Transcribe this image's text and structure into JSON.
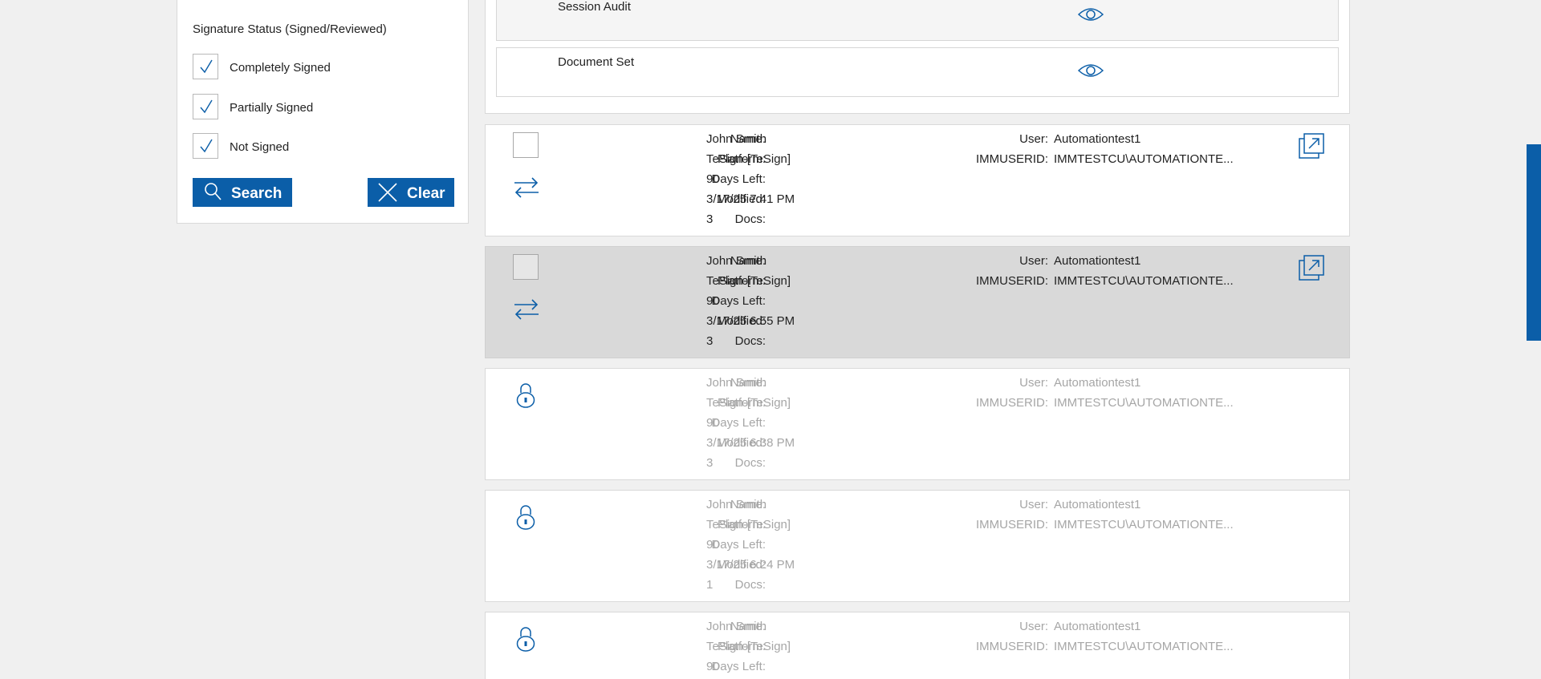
{
  "filter": {
    "title": "Signature Status (Signed/Reviewed)",
    "options": [
      {
        "label": "Completely Signed",
        "checked": true
      },
      {
        "label": "Partially Signed",
        "checked": true
      },
      {
        "label": "Not Signed",
        "checked": true
      }
    ],
    "search_label": "Search",
    "clear_label": "Clear"
  },
  "documents": [
    {
      "label": "Session Audit"
    },
    {
      "label": "Document Set"
    }
  ],
  "field_labels": {
    "name": "Name:",
    "platform": "Platform:",
    "days_left": "Days Left:",
    "modified": "Modified:",
    "docs": "Docs:",
    "user": "User:",
    "immuserid": "IMMUSERID:"
  },
  "sessions": [
    {
      "name": "John Smith",
      "platform": "TeSign-[TeSign]",
      "days_left": "90",
      "modified": "3/17/25 7:41 PM",
      "docs": "3",
      "user": "Automationtest1",
      "immuserid": "IMMTESTCU\\AUTOMATIONTE...",
      "locked": false,
      "selected": false
    },
    {
      "name": "John Smith",
      "platform": "TeSign-[TeSign]",
      "days_left": "90",
      "modified": "3/17/25 6:55 PM",
      "docs": "3",
      "user": "Automationtest1",
      "immuserid": "IMMTESTCU\\AUTOMATIONTE...",
      "locked": false,
      "selected": true
    },
    {
      "name": "John Smith",
      "platform": "TeSign-[TeSign]",
      "days_left": "90",
      "modified": "3/17/25 6:38 PM",
      "docs": "3",
      "user": "Automationtest1",
      "immuserid": "IMMTESTCU\\AUTOMATIONTE...",
      "locked": true,
      "selected": false
    },
    {
      "name": "John Smith",
      "platform": "TeSign-[TeSign]",
      "days_left": "90",
      "modified": "3/17/25 6:24 PM",
      "docs": "1",
      "user": "Automationtest1",
      "immuserid": "IMMTESTCU\\AUTOMATIONTE...",
      "locked": true,
      "selected": false
    },
    {
      "name": "John Smith",
      "platform": "TeSign-[TeSign]",
      "days_left": "90",
      "user": "Automationtest1",
      "immuserid": "IMMTESTCU\\AUTOMATIONTE...",
      "locked": true,
      "selected": false
    }
  ],
  "colors": {
    "accent": "#0b5ea8",
    "muted_text": "#a6a6a6",
    "selected_row": "#d9d9d9"
  },
  "icons": {
    "check": "check-icon",
    "search": "search-icon",
    "clear": "close-icon",
    "view": "eye-icon",
    "swap": "swap-arrows-icon",
    "open": "open-external-icon",
    "lock": "lock-icon"
  }
}
